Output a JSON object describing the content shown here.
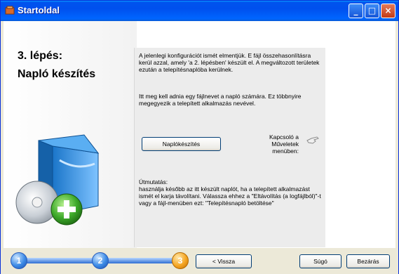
{
  "window": {
    "title": "Startoldal",
    "controls": {
      "minimize": "_",
      "maximize": "□",
      "close": "×"
    }
  },
  "left": {
    "step": "3. lépés:",
    "step_name": "Napló készítés"
  },
  "right": {
    "paragraph1": "A jelenlegi konfigurációt ismét elmentjük. E fájl összehasonlításra kerül azzal, amely 'a 2. lépésben' készült el. A megváltozott területek ezután a telepítésnaplóba kerülnek.",
    "paragraph2": "Itt meg kell adnia egy fájlnevet a napló számára. Ez többnyire megegyezik a telepített alkalmazás nevével.",
    "log_button": "Naplókészítés",
    "menu_label": "Kapcsoló a Műveletek menüben:",
    "instr_heading": "Útmutatás:",
    "instr_body": "használja később az itt készült naplót, ha a telepített alkalmazást ismét el karja távolítani. Válassza ehhez a \"Eltávolítás (a logfájlból)\"-t vagy a fájl-menüben ezt: \"Telepítésnapló betöltése\""
  },
  "footer": {
    "steps": [
      "1",
      "2",
      "3"
    ],
    "current_step": 3,
    "back_button": "< Vissza",
    "help_button": "Súgó",
    "close_button": "Bezárás"
  }
}
